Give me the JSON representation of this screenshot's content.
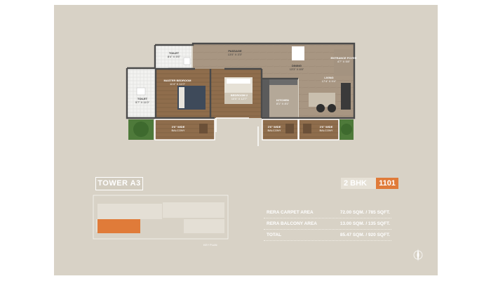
{
  "rooms": {
    "toilet_top": {
      "name": "TOILET",
      "dim": "8'4\" X 5'5\""
    },
    "passage": {
      "name": "PASSAGE",
      "dim": "13'0\" X 3'3\""
    },
    "dining": {
      "name": "DINING",
      "dim": "13'3\" X 8'8\""
    },
    "entrance_foyer": {
      "name": "ENTRANCE FOYER",
      "dim": "4'7\" X 5'8\""
    },
    "master_bedroom": {
      "name": "MASTER BEDROOM",
      "dim": "11'4\" X 11'0\""
    },
    "bedroom2": {
      "name": "BEDROOM 2",
      "dim": "10'0\" X 12'7\""
    },
    "living": {
      "name": "LIVING",
      "dim": "17'4\" X 9'4\""
    },
    "toilet_left": {
      "name": "TOILET",
      "dim": "5'7\" X 11'0\""
    },
    "kitchen": {
      "name": "KITCHEN",
      "dim": "8'1\" X 8'1\""
    },
    "balcony_left": {
      "name": "3'6\" WIDE",
      "label": "BALCONY"
    },
    "balcony_mid": {
      "name": "3'6\" WIDE",
      "label": "BALCONY"
    },
    "balcony_right": {
      "name": "3'6\" WIDE",
      "label": "BALCONY"
    }
  },
  "tower_title": "TOWER A3",
  "bhk": "2 BHK",
  "unit_no": "1101",
  "key_plan_label": "KEY PLAN",
  "areas": [
    {
      "label": "RERA CARPET AREA",
      "value": "72.00 SQM. / 785 SQFT."
    },
    {
      "label": "RERA BALCONY AREA",
      "value": "13.00 SQM. / 135 SQFT."
    },
    {
      "label": "TOTAL",
      "value": "85.47 SQM. / 920 SQFT."
    }
  ],
  "colors": {
    "panel": "#d8d2c6",
    "accent": "#e07b39",
    "floor_wood": "#8a6a4a",
    "floor_stone": "#b8a896",
    "wall": "#4a4a4a"
  }
}
